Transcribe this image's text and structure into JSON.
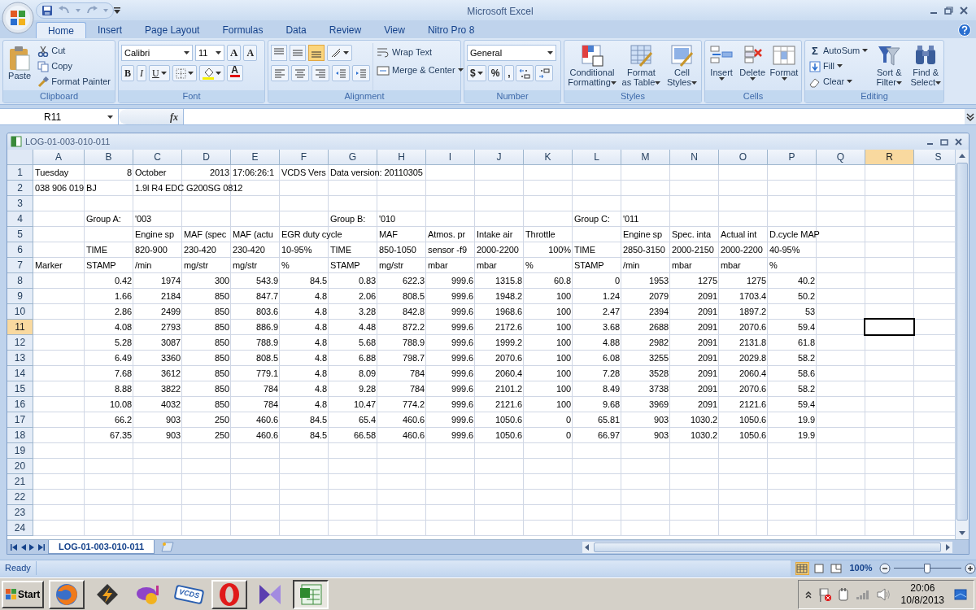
{
  "window": {
    "title": "Microsoft Excel"
  },
  "ribbon_tabs": [
    {
      "label": "Home",
      "selected": true
    },
    {
      "label": "Insert",
      "selected": false
    },
    {
      "label": "Page Layout",
      "selected": false
    },
    {
      "label": "Formulas",
      "selected": false
    },
    {
      "label": "Data",
      "selected": false
    },
    {
      "label": "Review",
      "selected": false
    },
    {
      "label": "View",
      "selected": false
    },
    {
      "label": "Nitro Pro 8",
      "selected": false
    }
  ],
  "ribbon": {
    "clipboard": {
      "label": "Clipboard",
      "paste": "Paste",
      "cut": "Cut",
      "copy": "Copy",
      "format_painter": "Format Painter"
    },
    "font": {
      "label": "Font",
      "font_name": "Calibri",
      "font_size": "11",
      "grow": "A",
      "shrink": "A",
      "bold": "B",
      "italic": "I",
      "underline": "U",
      "font_color": "A"
    },
    "alignment": {
      "label": "Alignment",
      "vertical": [
        {
          "selected": false
        },
        {
          "selected": false
        },
        {
          "selected": true
        }
      ],
      "wrap_text": "Wrap Text",
      "merge_center": "Merge & Center"
    },
    "number": {
      "label": "Number",
      "format": "General",
      "currency": "$",
      "percent": "%",
      "comma": ","
    },
    "styles": {
      "label": "Styles",
      "buttons": [
        "Conditional Formatting",
        "Format as Table",
        "Cell Styles"
      ]
    },
    "cells": {
      "label": "Cells",
      "buttons": [
        "Insert",
        "Delete",
        "Format"
      ]
    },
    "editing": {
      "label": "Editing",
      "autosum_symbol": "Σ",
      "autosum": "AutoSum",
      "fill": "Fill",
      "clear": "Clear",
      "sort_filter": "Sort & Filter",
      "find_select": "Find & Select"
    }
  },
  "formula_bar": {
    "name_box": "R11",
    "function_symbol": "fx"
  },
  "workbook": {
    "title": "LOG-01-003-010-011",
    "columns": [
      {
        "label": "A",
        "selected": false
      },
      {
        "label": "B",
        "selected": false
      },
      {
        "label": "C",
        "selected": false
      },
      {
        "label": "D",
        "selected": false
      },
      {
        "label": "E",
        "selected": false
      },
      {
        "label": "F",
        "selected": false
      },
      {
        "label": "G",
        "selected": false
      },
      {
        "label": "H",
        "selected": false
      },
      {
        "label": "I",
        "selected": false
      },
      {
        "label": "J",
        "selected": false
      },
      {
        "label": "K",
        "selected": false
      },
      {
        "label": "L",
        "selected": false
      },
      {
        "label": "M",
        "selected": false
      },
      {
        "label": "N",
        "selected": false
      },
      {
        "label": "O",
        "selected": false
      },
      {
        "label": "P",
        "selected": false
      },
      {
        "label": "Q",
        "selected": false
      },
      {
        "label": "R",
        "selected": true
      },
      {
        "label": "S",
        "selected": false
      }
    ],
    "rows": [
      {
        "label": "1",
        "selected": false,
        "cells": {
          "A": {
            "text": "Tuesday",
            "kind": "text"
          },
          "B": {
            "text": "8",
            "kind": "number"
          },
          "C": {
            "text": "October",
            "kind": "text"
          },
          "D": {
            "text": "2013",
            "kind": "number"
          },
          "E": {
            "text": "17:06:26:1",
            "kind": "text"
          },
          "F": {
            "text": "VCDS Vers",
            "kind": "text"
          },
          "G": {
            "text": "Data version: 20110305",
            "kind": "text"
          }
        }
      },
      {
        "label": "2",
        "selected": false,
        "cells": {
          "A": {
            "text": "038 906 019 BJ",
            "kind": "text"
          },
          "C": {
            "text": "1.9l R4 EDC G200SG  0812",
            "kind": "text"
          }
        }
      },
      {
        "label": "3",
        "selected": false
      },
      {
        "label": "4",
        "selected": false,
        "cells": {
          "B": {
            "text": "Group A:",
            "kind": "text"
          },
          "C": {
            "text": "'003",
            "kind": "text"
          },
          "G": {
            "text": "Group B:",
            "kind": "text"
          },
          "H": {
            "text": "'010",
            "kind": "text"
          },
          "L": {
            "text": "Group C:",
            "kind": "text"
          },
          "M": {
            "text": "'011",
            "kind": "text"
          }
        }
      },
      {
        "label": "5",
        "selected": false,
        "cells": {
          "C": {
            "text": "Engine sp",
            "kind": "text"
          },
          "D": {
            "text": "MAF (spec",
            "kind": "text"
          },
          "E": {
            "text": "MAF (actu",
            "kind": "text"
          },
          "F": {
            "text": "EGR duty cycle",
            "kind": "text"
          },
          "H": {
            "text": "MAF",
            "kind": "text"
          },
          "I": {
            "text": "Atmos. pr",
            "kind": "text"
          },
          "J": {
            "text": "Intake air",
            "kind": "text"
          },
          "K": {
            "text": "Throttle",
            "kind": "text"
          },
          "M": {
            "text": "Engine sp",
            "kind": "text"
          },
          "N": {
            "text": "Spec. inta",
            "kind": "text"
          },
          "O": {
            "text": "Actual int",
            "kind": "text"
          },
          "P": {
            "text": "D.cycle MAP",
            "kind": "text"
          }
        }
      },
      {
        "label": "6",
        "selected": false,
        "cells": {
          "B": {
            "text": "TIME",
            "kind": "text"
          },
          "C": {
            "text": "820-900",
            "kind": "text"
          },
          "D": {
            "text": "230-420",
            "kind": "text"
          },
          "E": {
            "text": "230-420",
            "kind": "text"
          },
          "F": {
            "text": "10-95%",
            "kind": "text"
          },
          "G": {
            "text": "TIME",
            "kind": "text"
          },
          "H": {
            "text": "850-1050",
            "kind": "text"
          },
          "I": {
            "text": "sensor -f9",
            "kind": "text"
          },
          "J": {
            "text": "2000-2200",
            "kind": "text"
          },
          "K": {
            "text": "100%",
            "kind": "number"
          },
          "L": {
            "text": "TIME",
            "kind": "text"
          },
          "M": {
            "text": "2850-3150",
            "kind": "text"
          },
          "N": {
            "text": "2000-2150",
            "kind": "text"
          },
          "O": {
            "text": "2000-2200",
            "kind": "text"
          },
          "P": {
            "text": "40-95%",
            "kind": "text"
          }
        }
      },
      {
        "label": "7",
        "selected": false,
        "cells": {
          "A": {
            "text": "Marker",
            "kind": "text"
          },
          "B": {
            "text": "STAMP",
            "kind": "text"
          },
          "C": {
            "text": "/min",
            "kind": "text"
          },
          "D": {
            "text": "mg/str",
            "kind": "text"
          },
          "E": {
            "text": "mg/str",
            "kind": "text"
          },
          "F": {
            "text": "%",
            "kind": "text"
          },
          "G": {
            "text": "STAMP",
            "kind": "text"
          },
          "H": {
            "text": "mg/str",
            "kind": "text"
          },
          "I": {
            "text": "mbar",
            "kind": "text"
          },
          "J": {
            "text": "mbar",
            "kind": "text"
          },
          "K": {
            "text": "%",
            "kind": "text"
          },
          "L": {
            "text": "STAMP",
            "kind": "text"
          },
          "M": {
            "text": "/min",
            "kind": "text"
          },
          "N": {
            "text": "mbar",
            "kind": "text"
          },
          "O": {
            "text": "mbar",
            "kind": "text"
          },
          "P": {
            "text": "%",
            "kind": "text"
          }
        }
      },
      {
        "label": "8",
        "selected": false,
        "values": [
          "0.42",
          "1974",
          "300",
          "543.9",
          "84.5",
          "0.83",
          "622.3",
          "999.6",
          "1315.8",
          "60.8",
          "0",
          "1953",
          "1275",
          "1275",
          "40.2"
        ]
      },
      {
        "label": "9",
        "selected": false,
        "values": [
          "1.66",
          "2184",
          "850",
          "847.7",
          "4.8",
          "2.06",
          "808.5",
          "999.6",
          "1948.2",
          "100",
          "1.24",
          "2079",
          "2091",
          "1703.4",
          "50.2"
        ]
      },
      {
        "label": "10",
        "selected": false,
        "values": [
          "2.86",
          "2499",
          "850",
          "803.6",
          "4.8",
          "3.28",
          "842.8",
          "999.6",
          "1968.6",
          "100",
          "2.47",
          "2394",
          "2091",
          "1897.2",
          "53"
        ]
      },
      {
        "label": "11",
        "selected": true,
        "values": [
          "4.08",
          "2793",
          "850",
          "886.9",
          "4.8",
          "4.48",
          "872.2",
          "999.6",
          "2172.6",
          "100",
          "3.68",
          "2688",
          "2091",
          "2070.6",
          "59.4"
        ]
      },
      {
        "label": "12",
        "selected": false,
        "values": [
          "5.28",
          "3087",
          "850",
          "788.9",
          "4.8",
          "5.68",
          "788.9",
          "999.6",
          "1999.2",
          "100",
          "4.88",
          "2982",
          "2091",
          "2131.8",
          "61.8"
        ]
      },
      {
        "label": "13",
        "selected": false,
        "values": [
          "6.49",
          "3360",
          "850",
          "808.5",
          "4.8",
          "6.88",
          "798.7",
          "999.6",
          "2070.6",
          "100",
          "6.08",
          "3255",
          "2091",
          "2029.8",
          "58.2"
        ]
      },
      {
        "label": "14",
        "selected": false,
        "values": [
          "7.68",
          "3612",
          "850",
          "779.1",
          "4.8",
          "8.09",
          "784",
          "999.6",
          "2060.4",
          "100",
          "7.28",
          "3528",
          "2091",
          "2060.4",
          "58.6"
        ]
      },
      {
        "label": "15",
        "selected": false,
        "values": [
          "8.88",
          "3822",
          "850",
          "784",
          "4.8",
          "9.28",
          "784",
          "999.6",
          "2101.2",
          "100",
          "8.49",
          "3738",
          "2091",
          "2070.6",
          "58.2"
        ]
      },
      {
        "label": "16",
        "selected": false,
        "values": [
          "10.08",
          "4032",
          "850",
          "784",
          "4.8",
          "10.47",
          "774.2",
          "999.6",
          "2121.6",
          "100",
          "9.68",
          "3969",
          "2091",
          "2121.6",
          "59.4"
        ]
      },
      {
        "label": "17",
        "selected": false,
        "values": [
          "66.2",
          "903",
          "250",
          "460.6",
          "84.5",
          "65.4",
          "460.6",
          "999.6",
          "1050.6",
          "0",
          "65.81",
          "903",
          "1030.2",
          "1050.6",
          "19.9"
        ]
      },
      {
        "label": "18",
        "selected": false,
        "values": [
          "67.35",
          "903",
          "250",
          "460.6",
          "84.5",
          "66.58",
          "460.6",
          "999.6",
          "1050.6",
          "0",
          "66.97",
          "903",
          "1030.2",
          "1050.6",
          "19.9"
        ]
      },
      {
        "label": "19",
        "selected": false
      },
      {
        "label": "20",
        "selected": false
      },
      {
        "label": "21",
        "selected": false
      },
      {
        "label": "22",
        "selected": false
      },
      {
        "label": "23",
        "selected": false
      },
      {
        "label": "24",
        "selected": false
      }
    ],
    "sheet_tabs": [
      {
        "label": "LOG-01-003-010-011",
        "selected": true
      }
    ]
  },
  "status_bar": {
    "status": "Ready",
    "views": [
      {
        "selected": true
      },
      {
        "selected": false
      },
      {
        "selected": false
      }
    ],
    "zoom": "100%",
    "zoom_slider": {
      "level": 0.5
    }
  },
  "taskbar": {
    "start": "Start",
    "apps": [
      {
        "kind": "browser",
        "running": true,
        "selected": false
      },
      {
        "kind": "lightning",
        "running": false,
        "selected": false
      },
      {
        "kind": "chat",
        "running": false,
        "selected": false
      },
      {
        "kind": "badge",
        "text": "VCDS",
        "running": false,
        "selected": false
      },
      {
        "kind": "ring",
        "running": true,
        "selected": false
      },
      {
        "kind": "bowtie",
        "running": false,
        "selected": false
      },
      {
        "kind": "spreadsheet",
        "running": true,
        "selected": true
      }
    ],
    "clock": {
      "time": "20:06",
      "date": "10/8/2013"
    }
  }
}
